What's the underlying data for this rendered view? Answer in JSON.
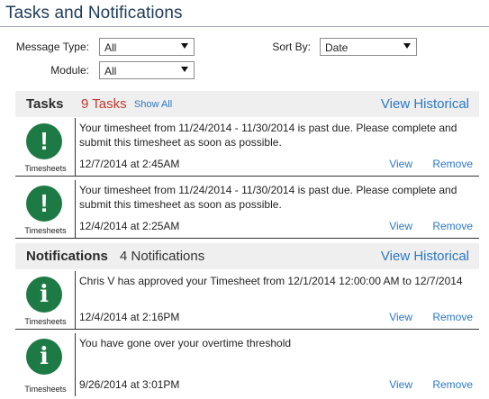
{
  "panel": {
    "title": "Tasks and Notifications"
  },
  "filters": {
    "message_type": {
      "label": "Message Type:",
      "value": "All"
    },
    "module": {
      "label": "Module:",
      "value": "All"
    },
    "sort_by": {
      "label": "Sort By:",
      "value": "Date"
    }
  },
  "tasks": {
    "title": "Tasks",
    "count_label": "9 Tasks",
    "show_all": "Show All",
    "view_historical": "View Historical",
    "items": [
      {
        "icon": "exclamation-icon",
        "module": "Timesheets",
        "message": "Your timesheet from 11/24/2014 - 11/30/2014 is past due. Please complete and submit this timesheet as soon as possible.",
        "date": "12/7/2014 at 2:45AM",
        "view": "View",
        "remove": "Remove"
      },
      {
        "icon": "exclamation-icon",
        "module": "Timesheets",
        "message": "Your timesheet from 11/24/2014 - 11/30/2014 is past due. Please complete and submit this timesheet as soon as possible.",
        "date": "12/4/2014 at 2:25AM",
        "view": "View",
        "remove": "Remove"
      }
    ]
  },
  "notifications": {
    "title": "Notifications",
    "count_label": "4 Notifications",
    "view_historical": "View Historical",
    "items": [
      {
        "icon": "info-icon",
        "module": "Timesheets",
        "message": "Chris V has approved your Timesheet from 12/1/2014 12:00:00 AM to 12/7/2014",
        "date": "12/4/2014 at 2:16PM",
        "view": "View",
        "remove": "Remove"
      },
      {
        "icon": "info-icon",
        "module": "Timesheets",
        "message": "You have gone over your overtime threshold",
        "date": "9/26/2014 at 3:01PM",
        "view": "View",
        "remove": "Remove"
      }
    ]
  },
  "colors": {
    "accent_link": "#2b78c5",
    "task_count": "#c0392b",
    "icon_green": "#1e7a45",
    "title_navy": "#1f3b5c"
  }
}
